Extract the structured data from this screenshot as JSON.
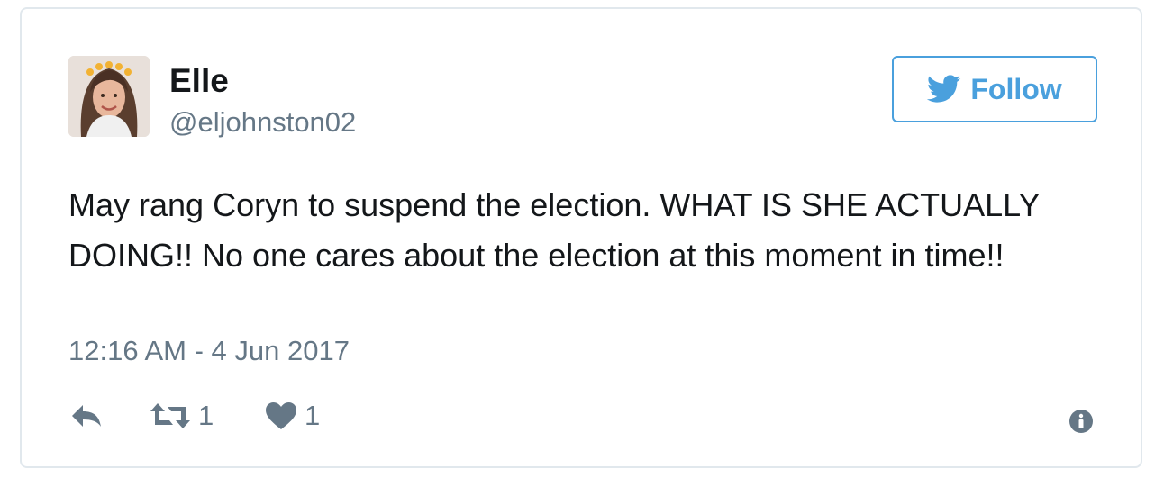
{
  "user": {
    "display_name": "Elle",
    "handle": "@eljohnston02",
    "avatar_icon": "profile-photo"
  },
  "follow": {
    "label": "Follow",
    "icon": "twitter-bird-icon",
    "color": "#4aa0dd"
  },
  "tweet": {
    "text": "May rang Coryn to suspend the election. WHAT IS SHE ACTUALLY DOING!! No one cares about the election at this moment in time!!",
    "timestamp": "12:16 AM - 4 Jun 2017"
  },
  "actions": {
    "reply_icon": "reply-icon",
    "retweet_icon": "retweet-icon",
    "retweet_count": "1",
    "like_icon": "heart-icon",
    "like_count": "1",
    "info_icon": "info-icon"
  },
  "colors": {
    "text": "#14171a",
    "secondary": "#657786",
    "border": "#e1e8ed"
  }
}
